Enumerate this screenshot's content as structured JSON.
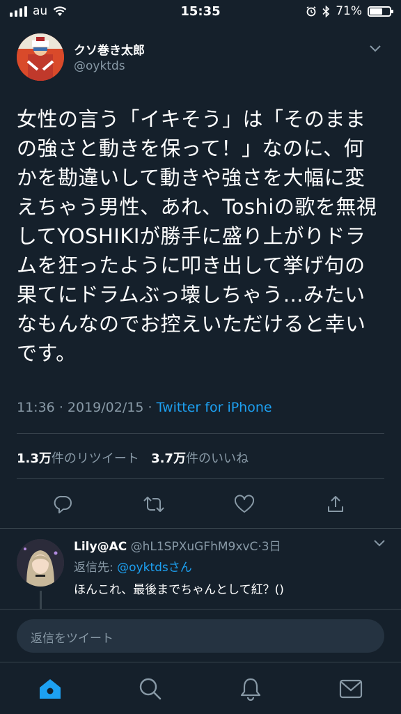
{
  "status": {
    "carrier": "au",
    "time": "15:35",
    "battery": "71%",
    "battery_level": 0.71
  },
  "tweet": {
    "author_name": "クソ巻き太郎",
    "author_handle": "@oyktds",
    "text_lines": [
      "女性の言う「イキそう」は「そのままの強さと動きを保って！」なのに、何かを勘違いして動きや強さを大幅に変えちゃう男性、あれ、Toshiの歌を無視してYOSHIKIが勝手に盛り上がりドラムを狂ったように叩き出して挙げ句の果てにドラムぶっ壊しちゃう…みたいなもんなのでお控えいただけると幸いです。"
    ],
    "time": "11:36",
    "date": "2019/02/15",
    "separator": "·",
    "source": "Twitter for iPhone",
    "retweets_count": "1.3万",
    "retweets_label": "件のリツイート",
    "likes_count": "3.7万",
    "likes_label": "件のいいね"
  },
  "text_display": [
    "女性の言う「イキそう」は「そのまま",
    "の強さと動きを保って！」なのに、何",
    "かを勘違いして動きや強さを大幅に変",
    "えちゃう男性、あれ、Toshiの歌を無視",
    "してYOSHIKIが勝手に盛り上がりドラ",
    "ムを狂ったように叩き出して挙げ句の",
    "果てにドラムぶっ壊しちゃう…みたい",
    "なもんなのでお控えいただけると幸い",
    "です。"
  ],
  "reply": {
    "name": "Lily@AC",
    "handle": "@hL1SPXuGFhM9xvC",
    "separator": "·",
    "age": "3日",
    "replying_to_label": "返信先:",
    "replying_to": "@oyktdsさん",
    "text": "ほんこれ、最後までちゃんとして紅？()"
  },
  "compose": {
    "placeholder": "返信をツイート"
  },
  "icons": [
    "reply-icon",
    "retweet-icon",
    "like-icon",
    "share-icon",
    "home-icon",
    "search-icon",
    "notifications-icon",
    "messages-icon"
  ],
  "colors": {
    "background": "#15202b",
    "accent": "#1da1f2",
    "secondary_text": "#8899a6"
  }
}
